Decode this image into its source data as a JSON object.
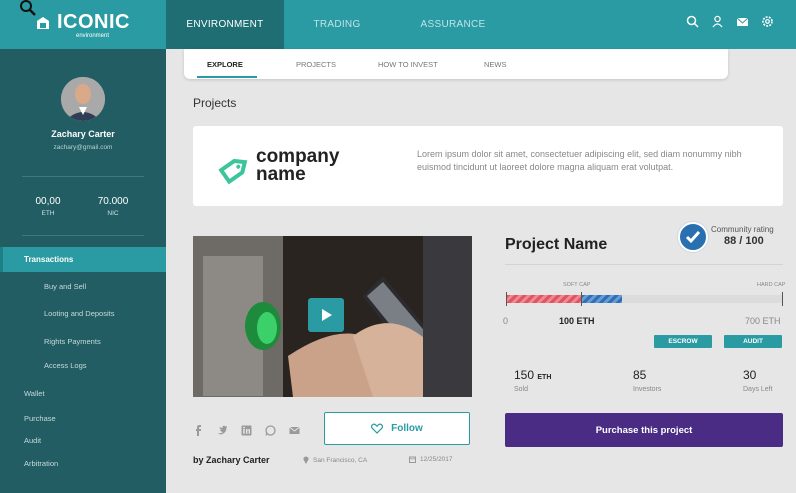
{
  "brand": {
    "name": "ICONIC",
    "subtitle": "environment"
  },
  "top_nav": {
    "items": [
      "ENVIRONMENT",
      "TRADING",
      "ASSURANCE"
    ],
    "active": "ENVIRONMENT"
  },
  "top_icons": [
    "search-icon",
    "user-icon",
    "mail-icon",
    "settings-icon"
  ],
  "user": {
    "name": "Zachary Carter",
    "email": "zachary@gmail.com"
  },
  "balances": [
    {
      "value": "00,00",
      "unit": "ETH"
    },
    {
      "value": "70.000",
      "unit": "NIC"
    }
  ],
  "sidebar": {
    "active": "Transactions",
    "sub_items": [
      "Buy and Sell",
      "Looting and Deposits",
      "Rights Payments",
      "Access Logs"
    ],
    "items": [
      "Wallet",
      "Purchase",
      "Audit",
      "Arbitration"
    ]
  },
  "tabs": {
    "items": [
      "EXPLORE",
      "PROJECTS",
      "HOW TO INVEST",
      "NEWS"
    ],
    "active": "EXPLORE"
  },
  "section_title": "Projects",
  "company": {
    "name_line1": "company",
    "name_line2": "name",
    "description": "Lorem ipsum dolor sit amet, consectetuer adipiscing elit, sed diam nonummy nibh euismod tincidunt ut laoreet dolore magna aliquam erat volutpat."
  },
  "project": {
    "name": "Project Name",
    "rating_label": "Community rating",
    "rating_value": "88 / 100",
    "soft_cap_label": "SOFT CAP",
    "hard_cap_label": "HARD CAP",
    "progress": {
      "min": 0,
      "soft_cap": 100,
      "hard_cap": 700,
      "raised_soft_fraction": 0.27,
      "raised_extra_fraction": 0.15
    },
    "min_label": "0",
    "soft_value_label": "100 ETH",
    "hard_value_label": "700 ETH",
    "escrow_label": "ESCROW",
    "audit_label": "AUDIT",
    "stats": [
      {
        "value": "150",
        "unit": "ETH",
        "label": "Sold"
      },
      {
        "value": "85",
        "unit": "",
        "label": "Investors"
      },
      {
        "value": "30",
        "unit": "",
        "label": "Days Left"
      }
    ],
    "purchase_label": "Purchase this project"
  },
  "social_icons": [
    "facebook-icon",
    "twitter-icon",
    "linkedin-icon",
    "whatsapp-icon",
    "email-icon"
  ],
  "follow_label": "Follow",
  "author": "by Zachary Carter",
  "location": "San Francisco, CA",
  "date": "12/25/2017",
  "colors": {
    "teal": "#2a9ba3",
    "sidebar": "#215d63",
    "purple": "#4a2c84",
    "red": "#e2545f",
    "blue": "#2f71b8"
  }
}
